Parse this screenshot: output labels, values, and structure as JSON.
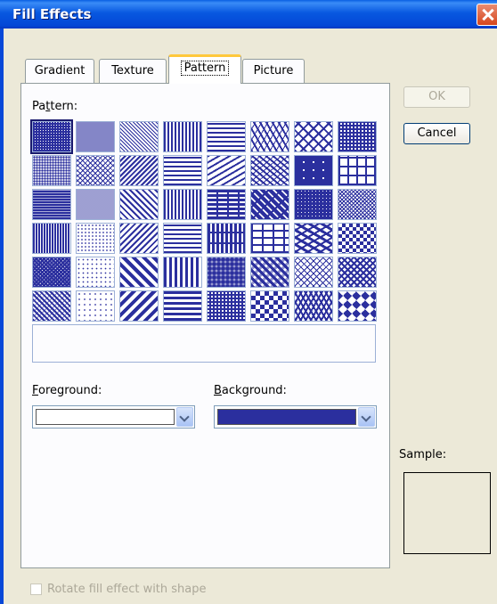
{
  "window": {
    "title": "Fill Effects"
  },
  "tabs": [
    {
      "label": "Gradient",
      "active": false
    },
    {
      "label": "Texture",
      "active": false
    },
    {
      "label": "Pattern",
      "active": true
    },
    {
      "label": "Picture",
      "active": false
    }
  ],
  "pattern": {
    "label_before": "Pa",
    "label_underline": "t",
    "label_after": "tern:",
    "foreground_color": "#2b2f9e",
    "background_color": "#ffffff",
    "cells": [
      "dots-dense",
      "dots-fine",
      "diag-down-fine",
      "vert-fine",
      "horiz-dash",
      "wave",
      "diamond-outline",
      "grid-fine",
      "dots-medium",
      "cross-diag-fine",
      "diag-up-fine",
      "horiz-fine",
      "diag-up-dash",
      "zigzag",
      "grid-large-dotted",
      "grid-large",
      "dots-heavy",
      "dots-light",
      "diag-down-medium",
      "vert-medium",
      "horiz-brick",
      "diag-brick",
      "weave-dense",
      "cross-diag-light",
      "vert-dash",
      "dots-sparse",
      "diag-up-medium",
      "horiz-medium",
      "vert-brick",
      "brick",
      "shingle",
      "checker-small",
      "checker-diag",
      "dots-very-sparse",
      "diag-down-wide",
      "vert-wide",
      "sphere",
      "weave",
      "dotted-diamond",
      "diamond-lattice",
      "plaid",
      "dots-tiny",
      "diag-up-wide",
      "horiz-wide",
      "trellis",
      "checker-large",
      "divot",
      "diamond-solid"
    ]
  },
  "foreground": {
    "label_underline": "F",
    "label_rest": "oreground:",
    "color": "#ffffff"
  },
  "background": {
    "label_underline": "B",
    "label_rest": "ackground:",
    "color": "#2b2f9e"
  },
  "buttons": {
    "ok": "OK",
    "cancel": "Cancel"
  },
  "sample": {
    "label": "Sample:"
  },
  "rotate_checkbox": {
    "label": "Rotate fill effect with shape",
    "checked": false
  }
}
